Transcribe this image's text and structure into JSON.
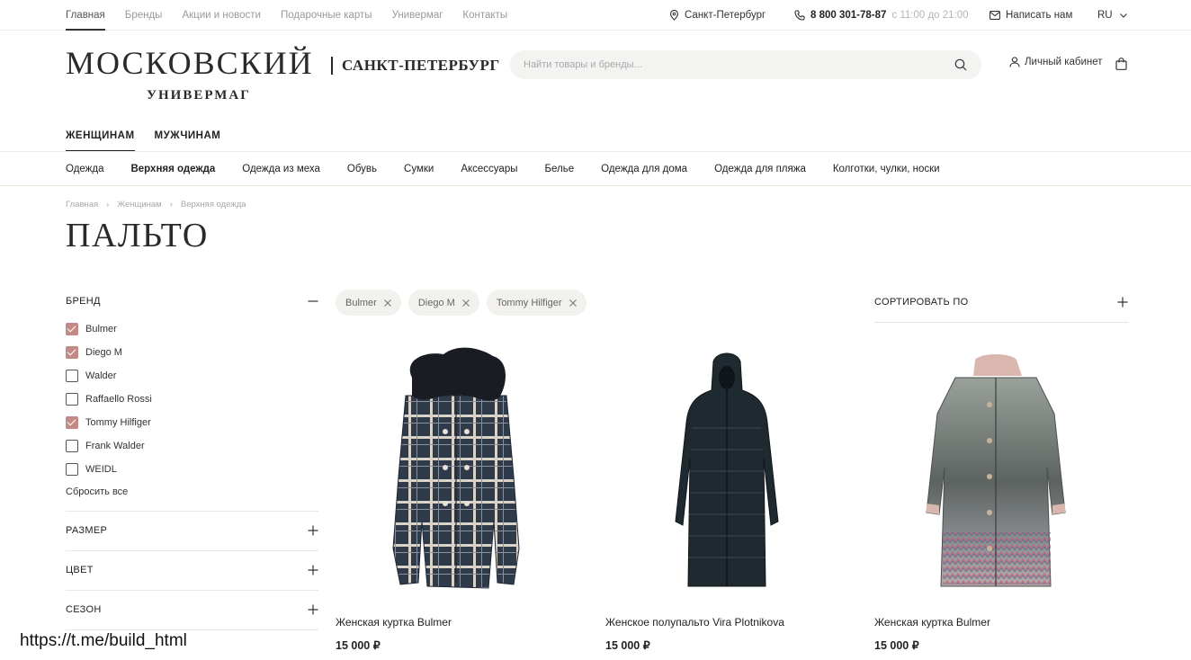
{
  "top_nav": [
    "Главная",
    "Бренды",
    "Акции и новости",
    "Подарочные карты",
    "Универмаг",
    "Контакты"
  ],
  "top_util": {
    "city": "Санкт-Петербург",
    "phone": "8 800 301-78-87",
    "hours": "с 11:00 до 21:00",
    "write_us": "Написать нам",
    "lang": "RU"
  },
  "logo": {
    "main": "МОСКОВСКИЙ",
    "sub": "УНИВЕРМАГ",
    "city": "САНКТ-ПЕТЕРБУРГ"
  },
  "search": {
    "placeholder": "Найти товары и бренды..."
  },
  "account_label": "Личный кабинет",
  "gender_tabs": [
    "ЖЕНЩИНАМ",
    "МУЖЧИНАМ"
  ],
  "categories": [
    "Одежда",
    "Верхняя одежда",
    "Одежда из меха",
    "Обувь",
    "Сумки",
    "Аксессуары",
    "Белье",
    "Одежда для дома",
    "Одежда для пляжа",
    "Колготки, чулки, носки"
  ],
  "breadcrumb": [
    "Главная",
    "Женщинам",
    "Верхняя одежда"
  ],
  "page_title": "ПАЛЬТО",
  "filters": {
    "brand_title": "БРЕНД",
    "brands": [
      {
        "name": "Bulmer",
        "checked": true
      },
      {
        "name": "Diego M",
        "checked": true
      },
      {
        "name": "Walder",
        "checked": false
      },
      {
        "name": "Raffaello Rossi",
        "checked": false
      },
      {
        "name": "Tommy Hilfiger",
        "checked": true
      },
      {
        "name": "Frank Walder",
        "checked": false
      },
      {
        "name": "WEIDL",
        "checked": false
      }
    ],
    "reset_label": "Сбросить все",
    "size_title": "РАЗМЕР",
    "color_title": "ЦВЕТ",
    "season_title": "СЕЗОН"
  },
  "chips": [
    "Bulmer",
    "Diego M",
    "Tommy Hilfiger"
  ],
  "sort_label": "СОРТИРОВАТЬ ПО",
  "products": [
    {
      "name": "Женская куртка Bulmer",
      "price": "15 000 ₽"
    },
    {
      "name": "Женское полупальто Vira Plotnikova",
      "price": "15 000 ₽"
    },
    {
      "name": "Женская куртка Bulmer",
      "price": "15 000 ₽"
    }
  ],
  "watermark": "https://t.me/build_html",
  "colors": {
    "accent_checkbox": "#c28a84",
    "chip_bg": "#f2f1ee",
    "divider_gold": "#ece7da"
  }
}
